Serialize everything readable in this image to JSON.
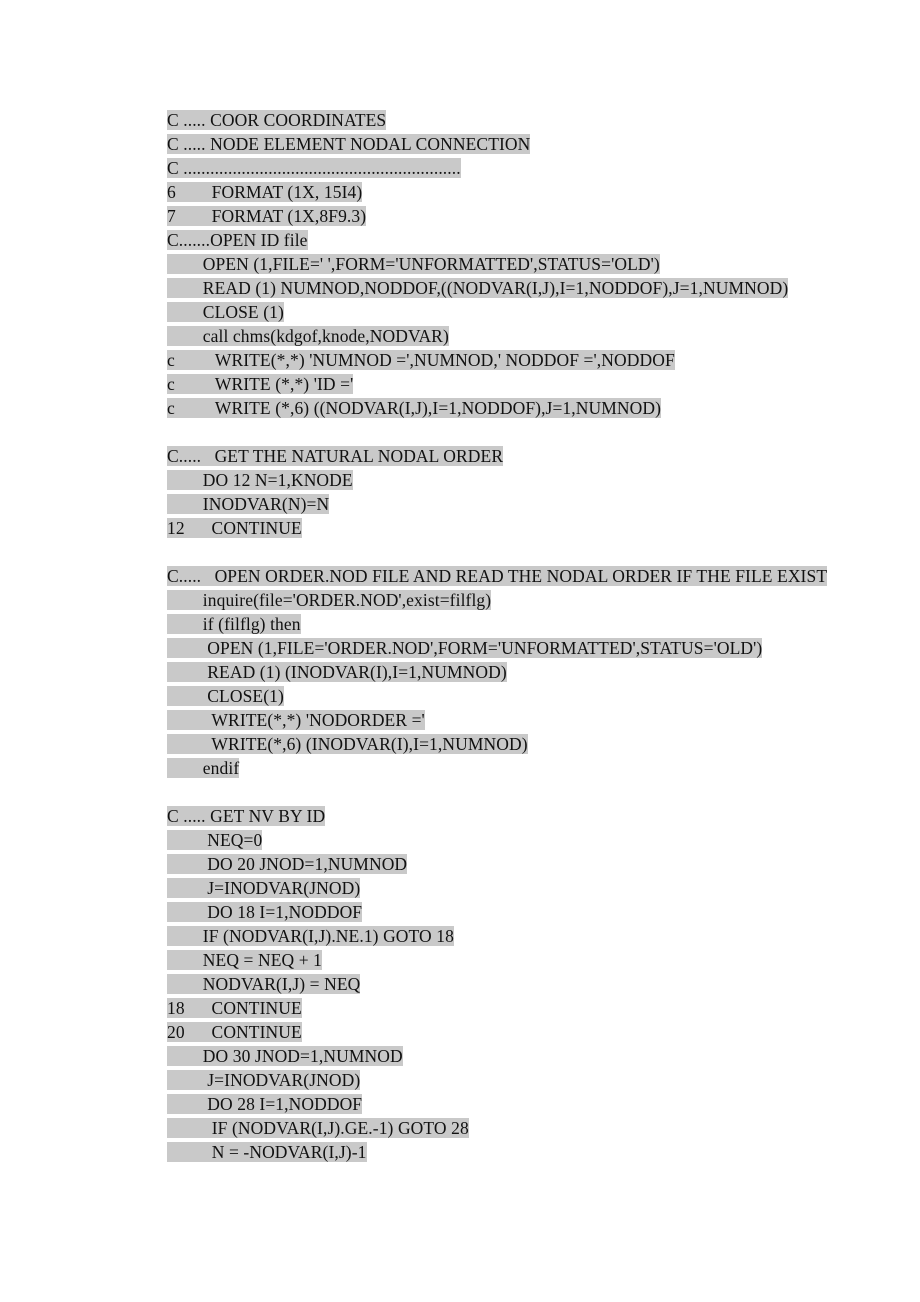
{
  "document": {
    "type": "source-code-listing",
    "language": "FORTRAN",
    "highlight_color": "#c9c9c9",
    "text_color": "#111111",
    "background_color": "#ffffff"
  },
  "lines": [
    {
      "id": "l1",
      "text": "C ..... COOR COORDINATES",
      "highlight": true
    },
    {
      "id": "l2",
      "text": "C ..... NODE ELEMENT NODAL CONNECTION",
      "highlight": true
    },
    {
      "id": "l3",
      "text": "C ..............................................................",
      "highlight": true
    },
    {
      "id": "l4",
      "text": "6        FORMAT (1X, 15I4)",
      "highlight": true
    },
    {
      "id": "l5",
      "text": "7        FORMAT (1X,8F9.3)",
      "highlight": true
    },
    {
      "id": "l6",
      "text": "C.......OPEN ID file",
      "highlight": true
    },
    {
      "id": "l7",
      "text": "        OPEN (1,FILE=' ',FORM='UNFORMATTED',STATUS='OLD')",
      "highlight": true
    },
    {
      "id": "l8",
      "text": "        READ (1) NUMNOD,NODDOF,((NODVAR(I,J),I=1,NODDOF),J=1,NUMNOD)",
      "highlight": true
    },
    {
      "id": "l9",
      "text": "        CLOSE (1)",
      "highlight": true
    },
    {
      "id": "l10",
      "text": "        call chms(kdgof,knode,NODVAR)",
      "highlight": true
    },
    {
      "id": "l11",
      "text": "c         WRITE(*,*) 'NUMNOD =',NUMNOD,' NODDOF =',NODDOF",
      "highlight": true
    },
    {
      "id": "l12",
      "text": "c         WRITE (*,*) 'ID ='",
      "highlight": true
    },
    {
      "id": "l13",
      "text": "c         WRITE (*,6) ((NODVAR(I,J),I=1,NODDOF),J=1,NUMNOD)",
      "highlight": true
    },
    {
      "id": "l14",
      "text": "",
      "highlight": false
    },
    {
      "id": "l15",
      "text": "C.....   GET THE NATURAL NODAL ORDER",
      "highlight": true
    },
    {
      "id": "l16",
      "text": "        DO 12 N=1,KNODE",
      "highlight": true
    },
    {
      "id": "l17",
      "text": "        INODVAR(N)=N",
      "highlight": true
    },
    {
      "id": "l18",
      "text": "12      CONTINUE",
      "highlight": true
    },
    {
      "id": "l19",
      "text": "",
      "highlight": false
    },
    {
      "id": "l20",
      "text": "C.....   OPEN ORDER.NOD FILE AND READ THE NODAL ORDER IF THE FILE EXIST",
      "highlight": true
    },
    {
      "id": "l21",
      "text": "        inquire(file='ORDER.NOD',exist=filflg)",
      "highlight": true
    },
    {
      "id": "l22",
      "text": "        if (filflg) then",
      "highlight": true
    },
    {
      "id": "l23",
      "text": "         OPEN (1,FILE='ORDER.NOD',FORM='UNFORMATTED',STATUS='OLD')",
      "highlight": true
    },
    {
      "id": "l24",
      "text": "         READ (1) (INODVAR(I),I=1,NUMNOD)",
      "highlight": true
    },
    {
      "id": "l25",
      "text": "         CLOSE(1)",
      "highlight": true
    },
    {
      "id": "l26",
      "text": "          WRITE(*,*) 'NODORDER ='",
      "highlight": true
    },
    {
      "id": "l27",
      "text": "          WRITE(*,6) (INODVAR(I),I=1,NUMNOD)",
      "highlight": true
    },
    {
      "id": "l28",
      "text": "        endif",
      "highlight": true
    },
    {
      "id": "l29",
      "text": "",
      "highlight": false
    },
    {
      "id": "l30",
      "text": "C ..... GET NV BY ID",
      "highlight": true
    },
    {
      "id": "l31",
      "text": "         NEQ=0",
      "highlight": true
    },
    {
      "id": "l32",
      "text": "         DO 20 JNOD=1,NUMNOD",
      "highlight": true
    },
    {
      "id": "l33",
      "text": "         J=INODVAR(JNOD)",
      "highlight": true
    },
    {
      "id": "l34",
      "text": "         DO 18 I=1,NODDOF",
      "highlight": true
    },
    {
      "id": "l35",
      "text": "        IF (NODVAR(I,J).NE.1) GOTO 18",
      "highlight": true
    },
    {
      "id": "l36",
      "text": "        NEQ = NEQ + 1",
      "highlight": true
    },
    {
      "id": "l37",
      "text": "        NODVAR(I,J) = NEQ",
      "highlight": true
    },
    {
      "id": "l38",
      "text": "18      CONTINUE",
      "highlight": true
    },
    {
      "id": "l39",
      "text": "20      CONTINUE",
      "highlight": true
    },
    {
      "id": "l40",
      "text": "        DO 30 JNOD=1,NUMNOD",
      "highlight": true
    },
    {
      "id": "l41",
      "text": "         J=INODVAR(JNOD)",
      "highlight": true
    },
    {
      "id": "l42",
      "text": "         DO 28 I=1,NODDOF",
      "highlight": true
    },
    {
      "id": "l43",
      "text": "          IF (NODVAR(I,J).GE.-1) GOTO 28",
      "highlight": true
    },
    {
      "id": "l44",
      "text": "          N = -NODVAR(I,J)-1",
      "highlight": true
    }
  ]
}
